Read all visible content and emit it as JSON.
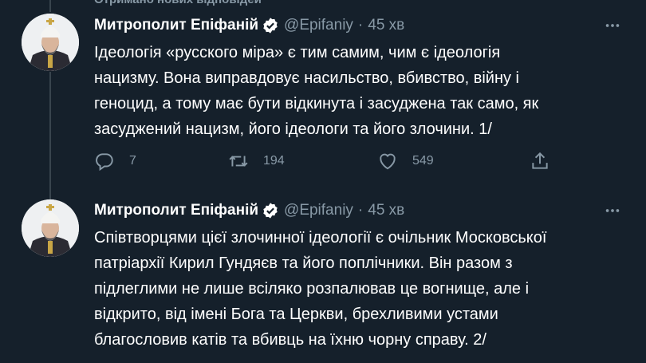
{
  "top_banner": {
    "text": "Отримано нових відповідей"
  },
  "tweets": [
    {
      "author_name": "Митрополит Епіфаній",
      "handle": "@Epifaniy",
      "separator": "·",
      "time": "45 хв",
      "text": "Ідеологія «русского міра» є тим самим, чим є ідеологія\nнацизму. Вона виправдовує насильство, вбивство, війну і\nгеноцид, а тому має бути відкинута і засуджена так само, як\nзасуджений нацизм, його ідеологи та його злочини. 1/",
      "replies": "7",
      "retweets": "194",
      "likes": "549"
    },
    {
      "author_name": "Митрополит Епіфаній",
      "handle": "@Epifaniy",
      "separator": "·",
      "time": "45 хв",
      "text": "Співтворцями цієї злочинної ідеології є очільник Московської\nпатріархії Кирил Гундяєв та його поплічники. Він разом з\nпідлеглими не лише всіляко розпалював це вогнище, але і\nвідкрито, від імені Бога та Церкви, брехливими устами\nблагословив катів та вбивць на їхню чорну справу. 2/"
    }
  ],
  "colors": {
    "background": "#15202b",
    "secondary_text": "#8899a6",
    "verified_badge": "#ffffff",
    "divider": "#38444d"
  },
  "icons": [
    "verified-badge-icon",
    "more-icon",
    "reply-icon",
    "retweet-icon",
    "like-icon",
    "share-icon"
  ]
}
